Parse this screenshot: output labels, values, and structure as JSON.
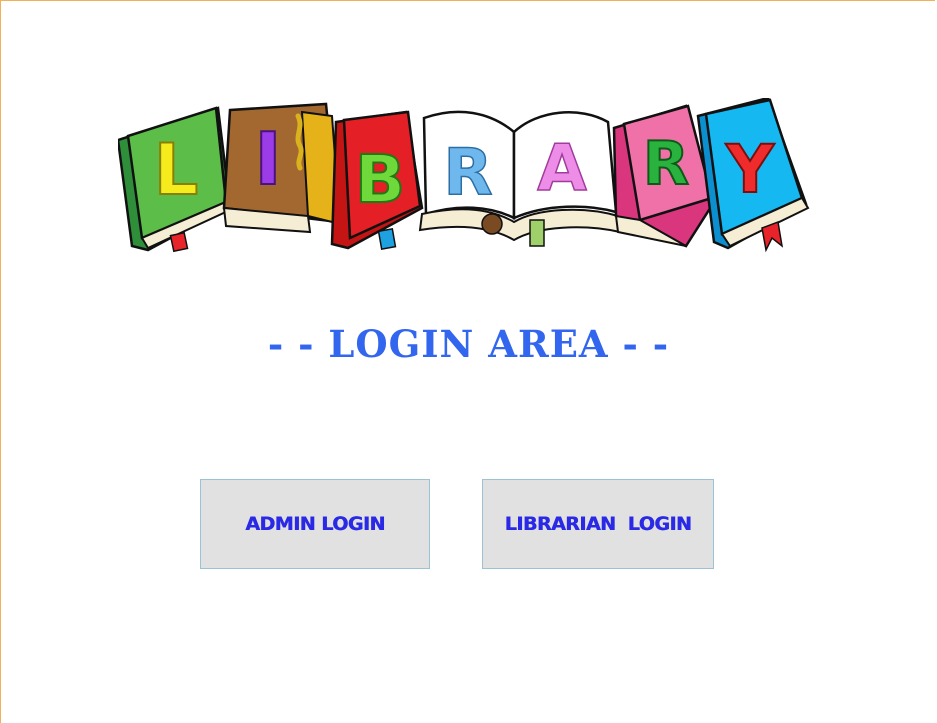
{
  "logo": {
    "letters": [
      "L",
      "I",
      "B",
      "R",
      "A",
      "R",
      "Y"
    ],
    "book_colors": [
      "#56b847",
      "#a26a33",
      "#e41f25",
      "#ffffff",
      "#ffffff",
      "#f070a8",
      "#16b8f2"
    ],
    "letter_colors": [
      "#f5ec1d",
      "#9b3ce8",
      "#6fd93c",
      "#6fb8ee",
      "#ee8de8",
      "#29b23e",
      "#ef2b2b"
    ]
  },
  "login_area": {
    "title": "- - LOGIN AREA - -"
  },
  "buttons": {
    "admin_label": "ADMIN LOGIN",
    "librarian_label": "LIBRARIAN  LOGIN"
  },
  "colors": {
    "title": "#3366ee",
    "button_text": "#2a2ae6",
    "button_bg": "#e1e1e1",
    "frame_border": "#f0b257"
  }
}
